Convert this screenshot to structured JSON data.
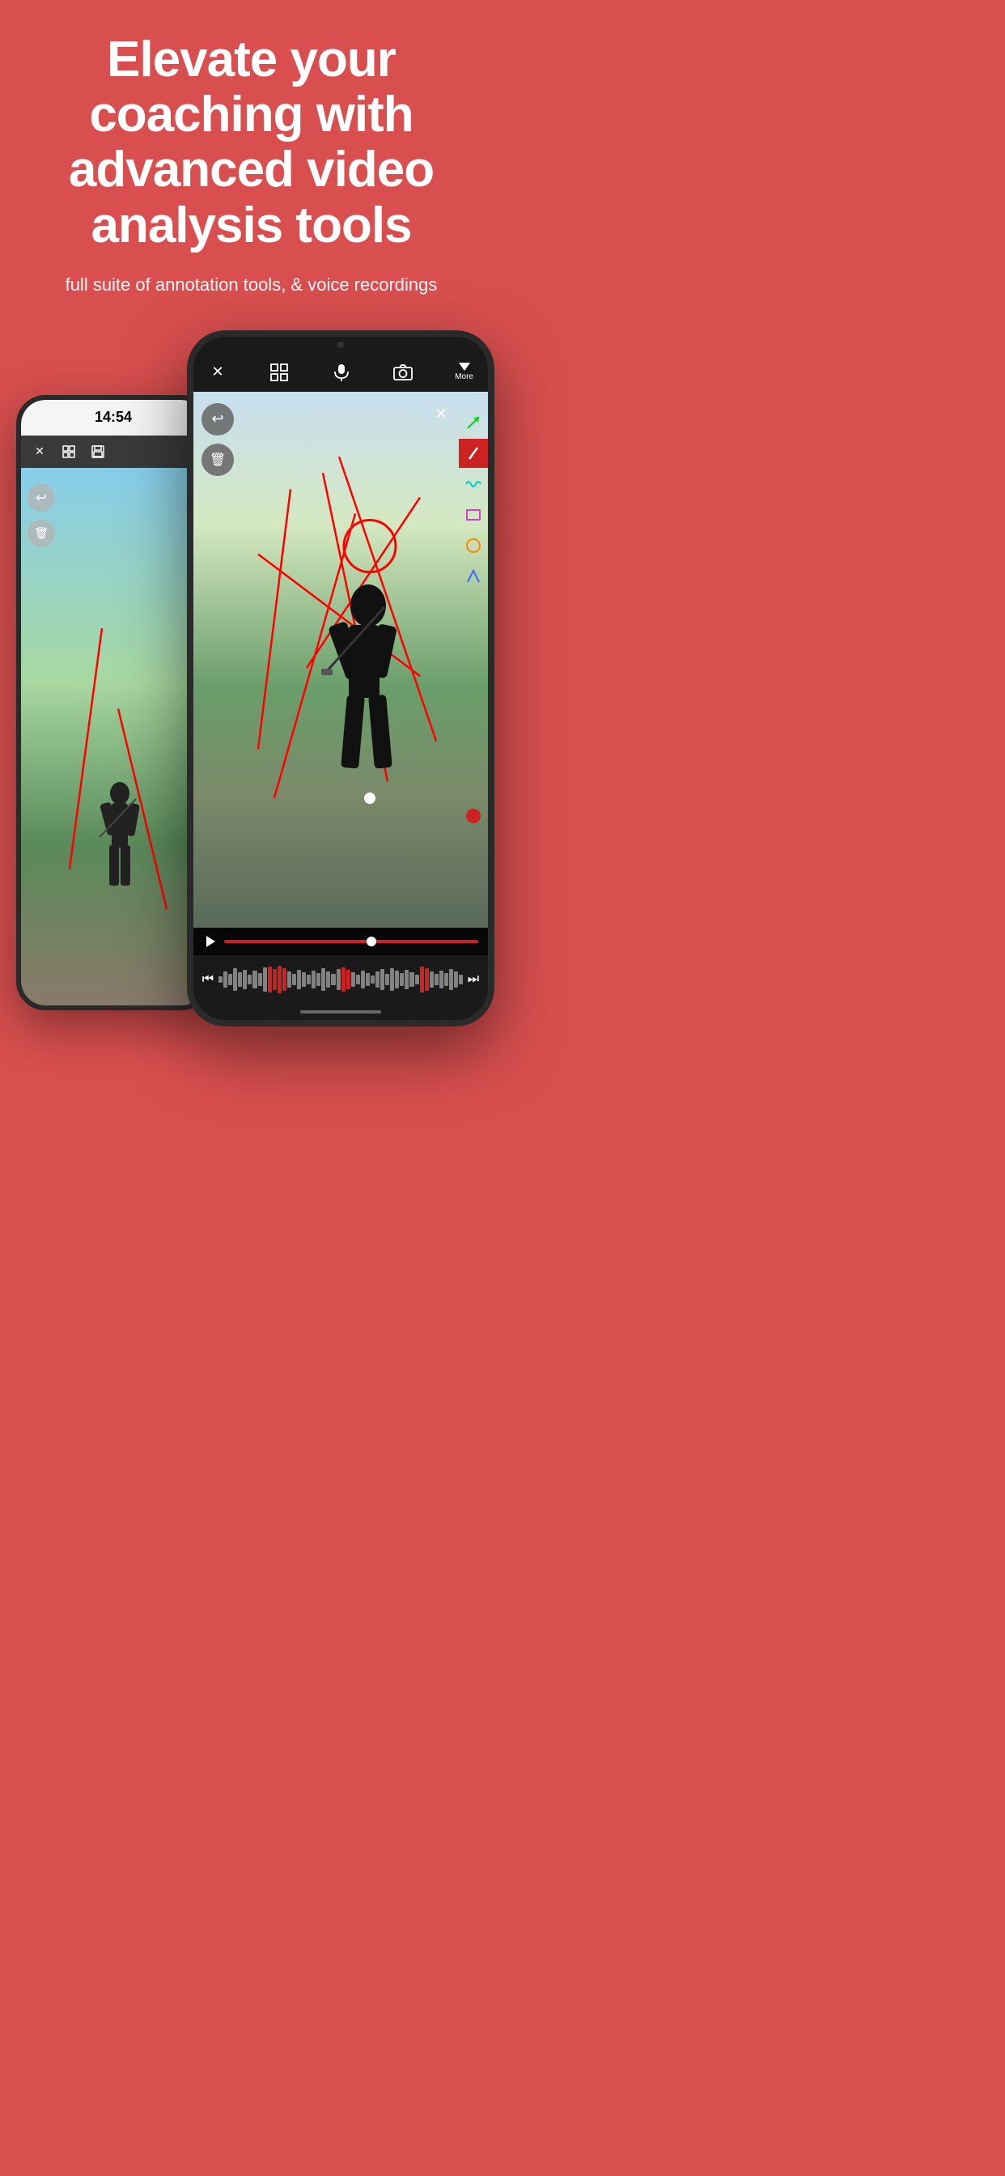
{
  "hero": {
    "title": "Elevate your coaching with advanced video analysis tools",
    "subtitle": "full suite of annotation tools, & voice recordings"
  },
  "back_phone": {
    "status_time": "14:54",
    "toolbar_icons": [
      "close",
      "grid",
      "save"
    ]
  },
  "front_phone": {
    "toolbar": {
      "close_label": "✕",
      "grid_label": "⊞",
      "mic_label": "🎤",
      "camera_label": "📷",
      "more_label": "More"
    },
    "annotation_tools": [
      {
        "name": "arrow",
        "color": "green"
      },
      {
        "name": "pen",
        "color": "red"
      },
      {
        "name": "wave",
        "color": "teal"
      },
      {
        "name": "rectangle",
        "color": "purple"
      },
      {
        "name": "circle",
        "color": "orange"
      },
      {
        "name": "angle",
        "color": "blue"
      }
    ],
    "record_button": "●"
  },
  "colors": {
    "background": "#d94f4f",
    "phone_body": "#1a1a1a",
    "toolbar": "#3a3a3a",
    "annotation_red": "#cc2222",
    "text_white": "#ffffff"
  }
}
